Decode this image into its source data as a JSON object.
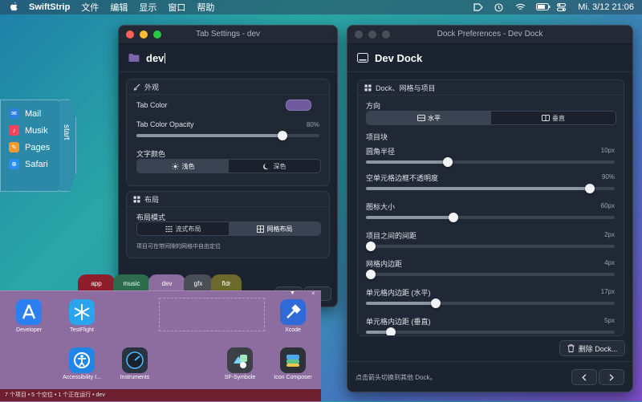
{
  "menubar": {
    "app_name": "SwiftStrip",
    "items": [
      "文件",
      "编辑",
      "显示",
      "窗口",
      "帮助"
    ],
    "clock": "Mi. 3/12  21:06"
  },
  "dock_strip": {
    "items": [
      {
        "label": "Mail",
        "color": "#2f7fe0"
      },
      {
        "label": "Musik",
        "color": "#f2435b"
      },
      {
        "label": "Pages",
        "color": "#f29a2e"
      },
      {
        "label": "Safari",
        "color": "#2a8df0"
      }
    ],
    "tab_label": "start"
  },
  "tab_settings": {
    "window_title": "Tab Settings - dev",
    "name_value": "dev",
    "appearance": {
      "heading": "外观",
      "tab_color_label": "Tab Color",
      "tab_color": "#6e5a9c",
      "opacity_label": "Tab Color Opacity",
      "opacity_value": "80%",
      "opacity_fraction": 0.8,
      "text_color_label": "文字颜色",
      "text_color_options": [
        "浅色",
        "深色"
      ],
      "text_color_selected": 0
    },
    "layout": {
      "heading": "布局",
      "mode_label": "布局模式",
      "mode_options": [
        "流式布局",
        "网格布局"
      ],
      "mode_selected": 1,
      "hint": "项目可在带间隙的网格中自由定位"
    }
  },
  "dock_prefs": {
    "window_title": "Dock Preferences - Dev Dock",
    "header": "Dev Dock",
    "section_heading": "Dock、网格与项目",
    "direction_label": "方向",
    "direction_options": [
      "水平",
      "垂直"
    ],
    "direction_selected": 0,
    "items_block_label": "项目块",
    "sliders": [
      {
        "label": "圆角半径",
        "value": "10px",
        "fraction": 0.33
      },
      {
        "label": "空单元格边框不透明度",
        "value": "90%",
        "fraction": 0.9
      },
      {
        "label": "图标大小",
        "value": "60px",
        "fraction": 0.35
      },
      {
        "label": "项目之间的间距",
        "value": "2px",
        "fraction": 0.02
      },
      {
        "label": "网格内边距",
        "value": "4px",
        "fraction": 0.02
      },
      {
        "label": "单元格内边距 (水平)",
        "value": "17px",
        "fraction": 0.28
      },
      {
        "label": "单元格内边距 (垂直)",
        "value": "5px",
        "fraction": 0.1
      }
    ],
    "delete_button": "删除 Dock...",
    "footer_hint": "点击箭头切换到其他 Dock。"
  },
  "tabs_bar": {
    "tabs": [
      {
        "label": "app",
        "color": "#8e1e2b"
      },
      {
        "label": "music",
        "color": "#2c6b4c"
      },
      {
        "label": "dev",
        "color": "#8d6da0"
      },
      {
        "label": "gfx",
        "color": "#4a4e57"
      },
      {
        "label": "fldr",
        "color": "#6b6a2c"
      }
    ],
    "selected": 2
  },
  "dev_panel": {
    "apps": [
      {
        "label": "Developer",
        "color": "#2c7ff0"
      },
      {
        "label": "TestFlight",
        "color": "#2aa4ec"
      },
      {
        "label": "Xcode",
        "color": "#2f6bd8"
      },
      {
        "label": "Accessibility I...",
        "color": "#1f86e8"
      },
      {
        "label": "Instruments",
        "color": "#2a3440"
      },
      {
        "label": "SF-Symbole",
        "color": "#3b3f46"
      },
      {
        "label": "Icon Composer",
        "color": "#2d3138"
      }
    ],
    "status": "7 个项目 • 5 个空位 • 1 个正在运行 • dev"
  }
}
